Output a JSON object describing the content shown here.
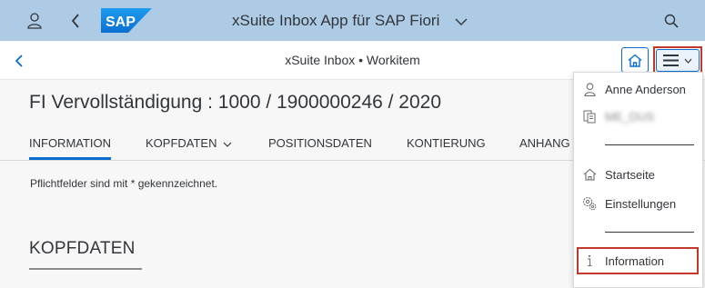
{
  "shell": {
    "logo_text": "SAP",
    "title": "xSuite Inbox App für SAP Fiori"
  },
  "subheader": {
    "title": "xSuite Inbox • Workitem"
  },
  "page": {
    "title": "FI Vervollständigung : 1000 / 1900000246 / 2020"
  },
  "tabs": [
    {
      "label": "INFORMATION",
      "active": true
    },
    {
      "label": "KOPFDATEN"
    },
    {
      "label": "POSITIONSDATEN"
    },
    {
      "label": "KONTIERUNG"
    },
    {
      "label": "ANHANG"
    }
  ],
  "content": {
    "required_note": "Pflichtfelder sind mit * gekennzeichnet.",
    "section_title": "KOPFDATEN"
  },
  "user_menu": {
    "user_name": "Anne Anderson",
    "user_id": "ME_DUS",
    "items": [
      {
        "label": "Startseite",
        "icon": "home-icon"
      },
      {
        "label": "Einstellungen",
        "icon": "settings-icon"
      },
      {
        "label": "Information",
        "icon": "info-icon"
      }
    ]
  },
  "colors": {
    "shellbar": "#aecbe6",
    "accent": "#0a6ed1",
    "highlight": "#c0392b"
  }
}
